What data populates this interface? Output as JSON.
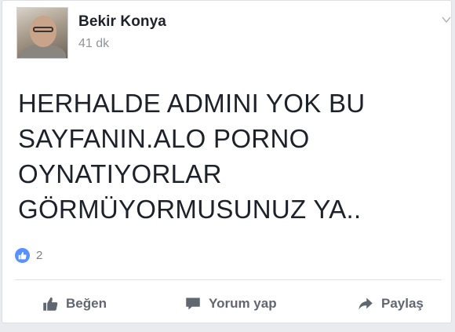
{
  "post": {
    "author": "Bekir Konya",
    "time": "41 dk",
    "text": "HERHALDE ADMINI YOK BU SAYFANIN.ALO PORNO OYNATIYORLAR GÖRMÜYORMUSUNUZ YA..",
    "text_lines": [
      "HERHALDE ADMINI YOK BU",
      "SAYFANIN.ALO PORNO",
      "OYNATIYORLAR",
      "GÖRMÜYORMUSUNUZ YA.."
    ],
    "reaction_count": "2",
    "options_icon": "chevron-down-icon"
  },
  "actions": {
    "like_label": "Beğen",
    "comment_label": "Yorum yap",
    "share_label": "Paylaş"
  },
  "colors": {
    "accent": "#5890ff",
    "action_text": "#616770",
    "author_text": "#1d2129",
    "meta_text": "#90949c"
  }
}
